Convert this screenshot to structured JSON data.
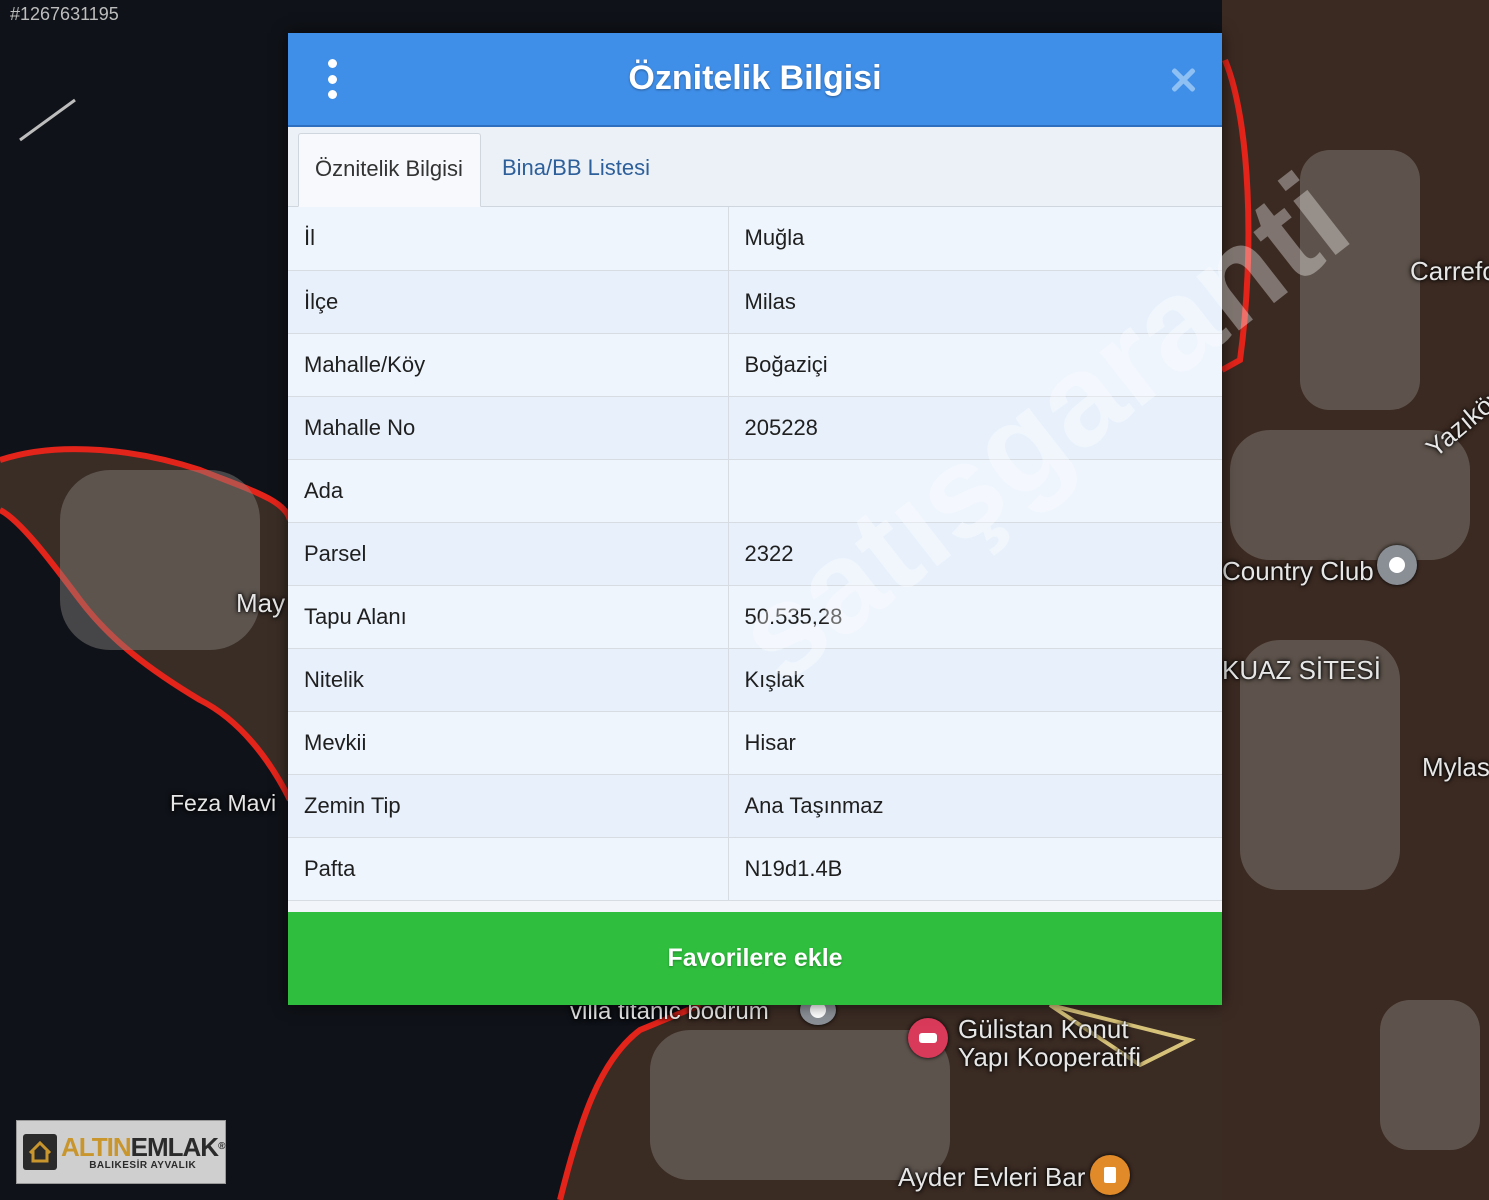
{
  "image_id": "#1267631195",
  "map": {
    "labels": {
      "carrefour": "Carrefo",
      "yazikoy": "Yazıköy S",
      "country_club": "Country Club",
      "kuaz_sitesi": "KUAZ SİTESİ",
      "mylas": "Mylas",
      "may": "May",
      "feza_mavi": "Feza Mavi",
      "villa_titanic": "villa titanic bodrum",
      "gulistan_1": "Gülistan Konut",
      "gulistan_2": "Yapı Kooperatifi",
      "ayder": "Ayder Evleri Bar"
    },
    "colors": {
      "boundary": "#e3241b",
      "water": "#0f1218",
      "land": "#3a2a22"
    }
  },
  "logo": {
    "brand_a": "ALTIN",
    "brand_b": "EMLAK",
    "registered": "®",
    "subtitle": "BALIKESİR AYVALIK"
  },
  "dialog": {
    "title": "Öznitelik Bilgisi",
    "tabs": [
      {
        "label": "Öznitelik Bilgisi",
        "active": true
      },
      {
        "label": "Bina/BB Listesi",
        "active": false
      }
    ],
    "rows": [
      {
        "key": "İl",
        "value": "Muğla"
      },
      {
        "key": "İlçe",
        "value": "Milas"
      },
      {
        "key": "Mahalle/Köy",
        "value": "Boğaziçi"
      },
      {
        "key": "Mahalle No",
        "value": "205228"
      },
      {
        "key": "Ada",
        "value": ""
      },
      {
        "key": "Parsel",
        "value": "2322"
      },
      {
        "key": "Tapu Alanı",
        "value": "50.535,28"
      },
      {
        "key": "Nitelik",
        "value": "Kışlak"
      },
      {
        "key": "Mevkii",
        "value": "Hisar"
      },
      {
        "key": "Zemin Tip",
        "value": "Ana Taşınmaz"
      },
      {
        "key": "Pafta",
        "value": "N19d1.4B"
      }
    ],
    "favorite_button": "Favorilere ekle",
    "watermark": "satışgaranti"
  },
  "colors": {
    "header": "#3f8ee8",
    "favorite": "#2fbe3d",
    "tab_link": "#2d5f9a"
  }
}
